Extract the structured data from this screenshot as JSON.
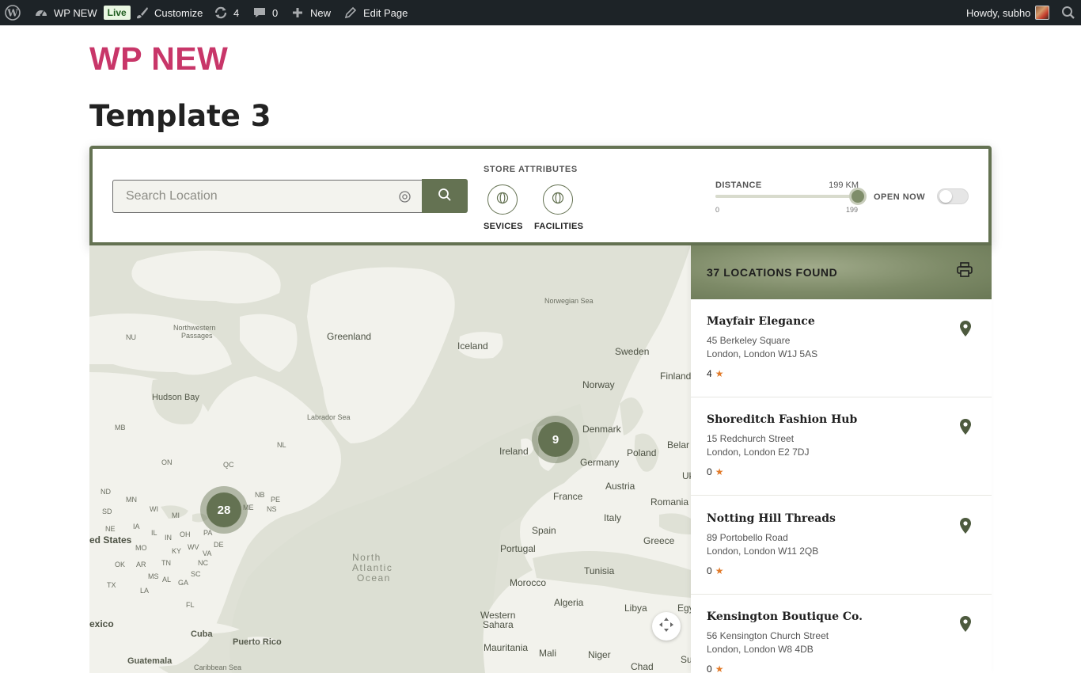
{
  "adminbar": {
    "site_name": "WP NEW",
    "live_badge": "Live",
    "customize": "Customize",
    "updates_count": "4",
    "comments_count": "0",
    "new_label": "New",
    "edit_page": "Edit Page",
    "howdy": "Howdy, subho"
  },
  "site": {
    "title": "WP NEW",
    "page_title": "Template 3"
  },
  "filters": {
    "search_placeholder": "Search Location",
    "attributes_heading": "STORE ATTRIBUTES",
    "attributes": [
      {
        "label": "SEVICES"
      },
      {
        "label": "FACILITIES"
      }
    ],
    "distance_label": "DISTANCE",
    "distance_value": "199 KM",
    "distance_min": "0",
    "distance_max": "199",
    "distance_current": 199,
    "open_now_label": "OPEN NOW",
    "open_now_enabled": false
  },
  "map": {
    "labels": {
      "greenland": "Greenland",
      "iceland": "Iceland",
      "norwegian_sea": "Norwegian Sea",
      "sweden": "Sweden",
      "finland": "Finland",
      "norway": "Norway",
      "northwestern_passages_1": "Northwestern",
      "northwestern_passages_2": "Passages",
      "nu": "NU",
      "hudson_bay": "Hudson Bay",
      "labrador_sea": "Labrador Sea",
      "mb": "MB",
      "on": "ON",
      "qc": "QC",
      "nl": "NL",
      "nd": "ND",
      "mn": "MN",
      "sd": "SD",
      "wi": "WI",
      "mi": "MI",
      "ne": "NE",
      "ia": "IA",
      "il": "IL",
      "in": "IN",
      "oh": "OH",
      "pa": "PA",
      "me": "ME",
      "nb": "NB",
      "pe": "PE",
      "ns": "NS",
      "de": "DE",
      "united_states": "ed States",
      "mo": "MO",
      "ky": "KY",
      "wv": "WV",
      "va": "VA",
      "ok": "OK",
      "ar": "AR",
      "tn": "TN",
      "nc": "NC",
      "ms": "MS",
      "al": "AL",
      "ga": "GA",
      "sc": "SC",
      "tx": "TX",
      "la": "LA",
      "fl": "FL",
      "mexico": "exico",
      "cuba": "Cuba",
      "puerto_rico": "Puerto Rico",
      "guatemala": "Guatemala",
      "caribbean_sea": "Caribbean Sea",
      "ocean_1": "North",
      "ocean_2": "Atlantic",
      "ocean_3": "Ocean",
      "ireland": "Ireland",
      "denmark": "Denmark",
      "germany": "Germany",
      "poland": "Poland",
      "belarus": "Belar",
      "ukraine": "Uk",
      "austria": "Austria",
      "france": "France",
      "romania": "Romania",
      "italy": "Italy",
      "spain": "Spain",
      "portugal": "Portugal",
      "greece": "Greece",
      "tunisia": "Tunisia",
      "morocco": "Morocco",
      "algeria": "Algeria",
      "libya": "Libya",
      "egypt": "Egy",
      "western_sahara_1": "Western",
      "western_sahara_2": "Sahara",
      "mauritania": "Mauritania",
      "mali": "Mali",
      "niger": "Niger",
      "chad": "Chad",
      "sudan": "Su"
    },
    "clusters": [
      {
        "count": "28"
      },
      {
        "count": "9"
      }
    ]
  },
  "results": {
    "count_label": "37 LOCATIONS FOUND",
    "stores": [
      {
        "name": "Mayfair Elegance",
        "street": "45 Berkeley Square",
        "city": "London, London W1J 5AS",
        "rating": "4"
      },
      {
        "name": "Shoreditch Fashion Hub",
        "street": "15 Redchurch Street",
        "city": "London, London E2 7DJ",
        "rating": "0"
      },
      {
        "name": "Notting Hill Threads",
        "street": "89 Portobello Road",
        "city": "London, London W11 2QB",
        "rating": "0"
      },
      {
        "name": "Kensington Boutique Co.",
        "street": "56 Kensington Church Street",
        "city": "London, London W8 4DB",
        "rating": "0"
      }
    ]
  },
  "colors": {
    "accent": "#647252",
    "site_title": "#c83669",
    "admin_bar": "#1d2327",
    "star": "#e27b2a"
  },
  "icons": [
    "wordpress-icon",
    "dashboard-icon",
    "brush-icon",
    "updates-icon",
    "comment-icon",
    "plus-icon",
    "pencil-icon",
    "search-icon",
    "locate-icon",
    "print-icon",
    "map-pin-icon",
    "fullscreen-icon",
    "star-icon"
  ]
}
